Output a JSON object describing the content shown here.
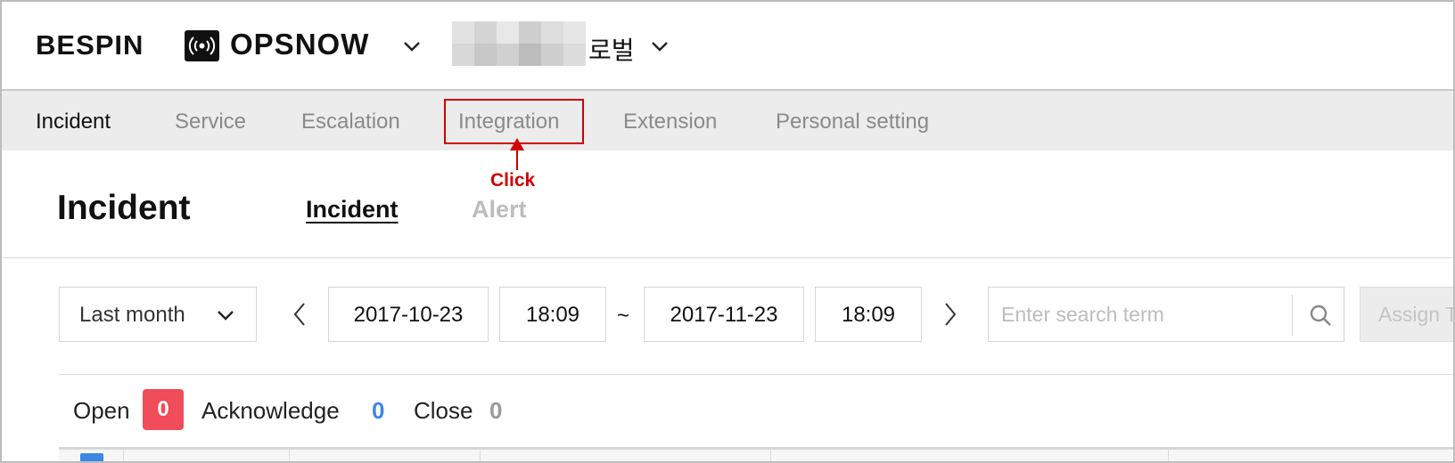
{
  "header": {
    "brand": "BESPIN",
    "app_name": "OPSNOW",
    "account_label": "로벌"
  },
  "nav": {
    "items": [
      {
        "label": "Incident",
        "active": true
      },
      {
        "label": "Service",
        "active": false
      },
      {
        "label": "Escalation",
        "active": false
      },
      {
        "label": "Integration",
        "active": false,
        "highlighted": true
      },
      {
        "label": "Extension",
        "active": false
      },
      {
        "label": "Personal setting",
        "active": false
      }
    ]
  },
  "annotation": {
    "text": "Click",
    "color": "#d10000"
  },
  "page": {
    "title": "Incident",
    "tabs": [
      {
        "label": "Incident",
        "active": true
      },
      {
        "label": "Alert",
        "active": false
      }
    ]
  },
  "filters": {
    "period": "Last month",
    "start_date": "2017-10-23",
    "start_time": "18:09",
    "separator": "~",
    "end_date": "2017-11-23",
    "end_time": "18:09",
    "search_placeholder": "Enter search term",
    "assign_label": "Assign T"
  },
  "status": {
    "open_label": "Open",
    "open_count": "0",
    "acknowledge_label": "Acknowledge",
    "acknowledge_count": "0",
    "close_label": "Close",
    "close_count": "0"
  },
  "colors": {
    "open_badge": "#f04c5a",
    "acknowledge": "#3d86e6",
    "close": "#9a9a9a",
    "nav_bg": "#ececec"
  }
}
